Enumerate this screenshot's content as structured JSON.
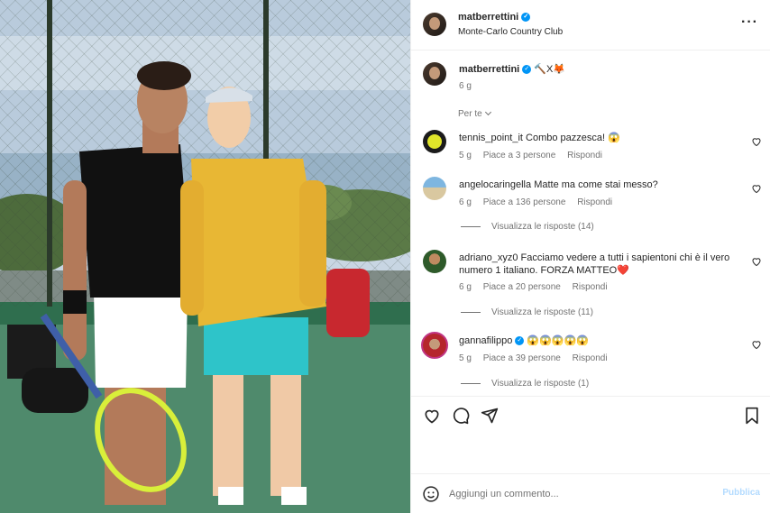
{
  "post": {
    "username": "matberrettini",
    "location": "Monte-Carlo Country Club",
    "caption": "🔨X🦊",
    "time": "6 g"
  },
  "sort_label": "Per te",
  "comments": [
    {
      "username": "tennis_point_it",
      "text": "Combo pazzesca! 😱",
      "time": "5 g",
      "likes": "Piace a 3 persone",
      "reply": "Rispondi",
      "replies": ""
    },
    {
      "username": "angelocaringella",
      "text": "Matte ma come stai messo?",
      "time": "6 g",
      "likes": "Piace a 136 persone",
      "reply": "Rispondi",
      "replies": "Visualizza le risposte (14)"
    },
    {
      "username": "adriano_xyz0",
      "text": "Facciamo vedere a tutti i sapientoni chi è il vero numero 1 italiano. FORZA MATTEO❤️",
      "time": "6 g",
      "likes": "Piace a 20 persone",
      "reply": "Rispondi",
      "replies": "Visualizza le risposte (11)"
    },
    {
      "username": "gannafilippo",
      "text": "😱😱😱😱😱",
      "time": "5 g",
      "likes": "Piace a 39 persone",
      "reply": "Rispondi",
      "replies": "Visualizza le risposte (1)"
    }
  ],
  "composer": {
    "placeholder": "Aggiungi un commento...",
    "post_label": "Pubblica"
  },
  "icons": {
    "verified": "verified-badge-icon",
    "more": "more-options-icon",
    "like": "heart-icon",
    "comment": "comment-bubble-icon",
    "share": "send-icon",
    "save": "bookmark-icon",
    "emoji": "emoji-icon"
  },
  "colors": {
    "verified": "#0095f6",
    "secondary_text": "#737373",
    "post_button_disabled": "#b3dbff"
  }
}
